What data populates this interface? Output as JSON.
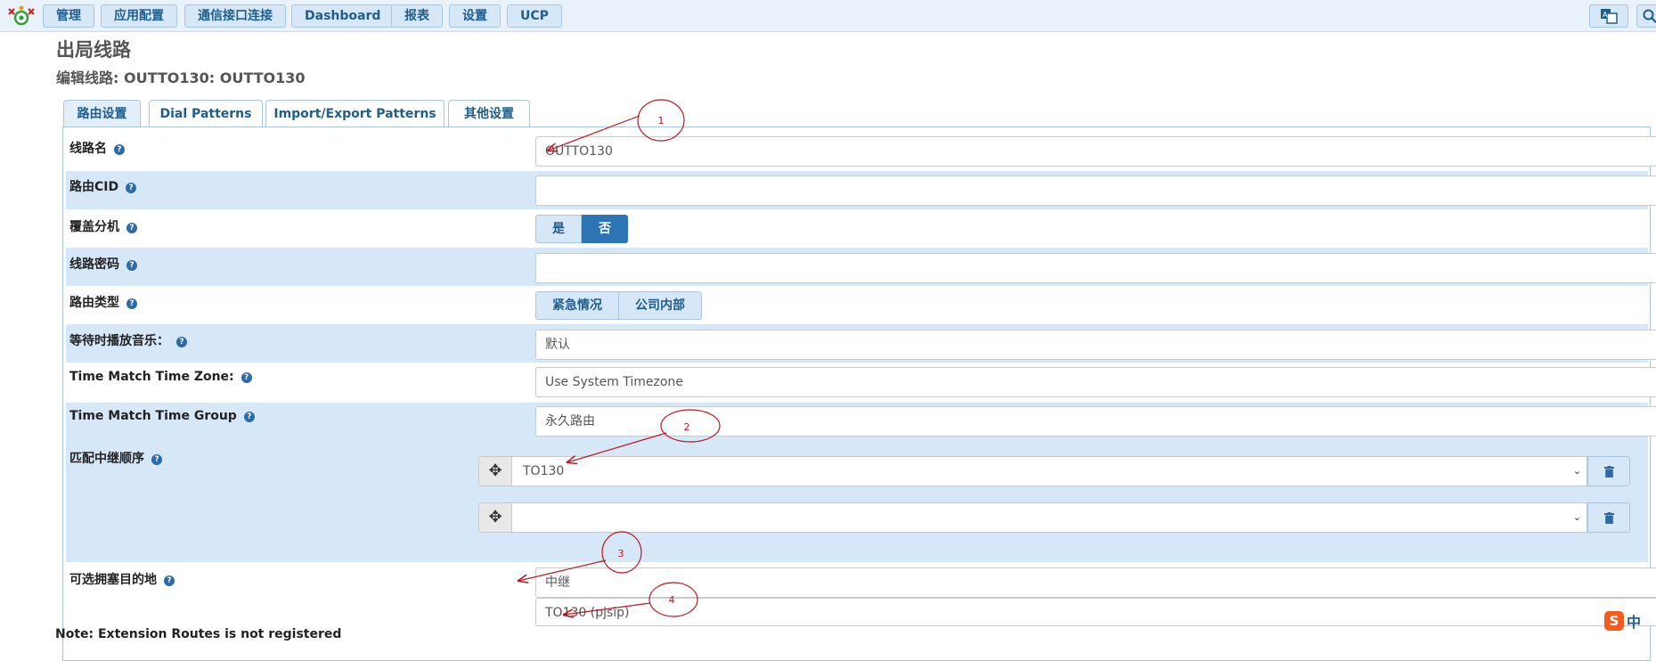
{
  "nav": {
    "items": [
      "管理",
      "应用配置",
      "通信接口连接",
      "Dashboard",
      "报表",
      "设置",
      "UCP"
    ]
  },
  "header": {
    "title": "出局线路",
    "subtitle": "编辑线路: OUTTO130: OUTTO130"
  },
  "tabs": [
    "路由设置",
    "Dial Patterns",
    "Import/Export Patterns",
    "其他设置"
  ],
  "form": {
    "route_name": {
      "label": "线路名",
      "value": "OUTTO130"
    },
    "route_cid": {
      "label": "路由CID",
      "value": ""
    },
    "override_extension": {
      "label": "覆盖分机",
      "options": [
        "是",
        "否"
      ],
      "selected": "否"
    },
    "route_password": {
      "label": "线路密码",
      "value": ""
    },
    "route_type": {
      "label": "路由类型",
      "options": [
        "紧急情况",
        "公司内部"
      ]
    },
    "music_on_hold": {
      "label": "等待时播放音乐：",
      "value": "默认"
    },
    "time_zone": {
      "label": "Time Match Time Zone:",
      "value": "Use System Timezone"
    },
    "time_group": {
      "label": "Time Match Time Group",
      "value": "永久路由"
    },
    "trunk_sequence": {
      "label": "匹配中继顺序",
      "trunks": [
        "TO130",
        ""
      ]
    },
    "optional_destination": {
      "label": "可选拥塞目的地",
      "type_value": "中继",
      "target_value": "TO130 (pjsip)"
    }
  },
  "note": "Note: Extension Routes is not registered",
  "annotations": [
    "1",
    "2",
    "3",
    "4"
  ],
  "ime": {
    "brand": "S",
    "lang": "中"
  },
  "colors": {
    "accent": "#2c74b3",
    "row_alt": "#d6e8f7",
    "annotation": "#c0161c"
  }
}
